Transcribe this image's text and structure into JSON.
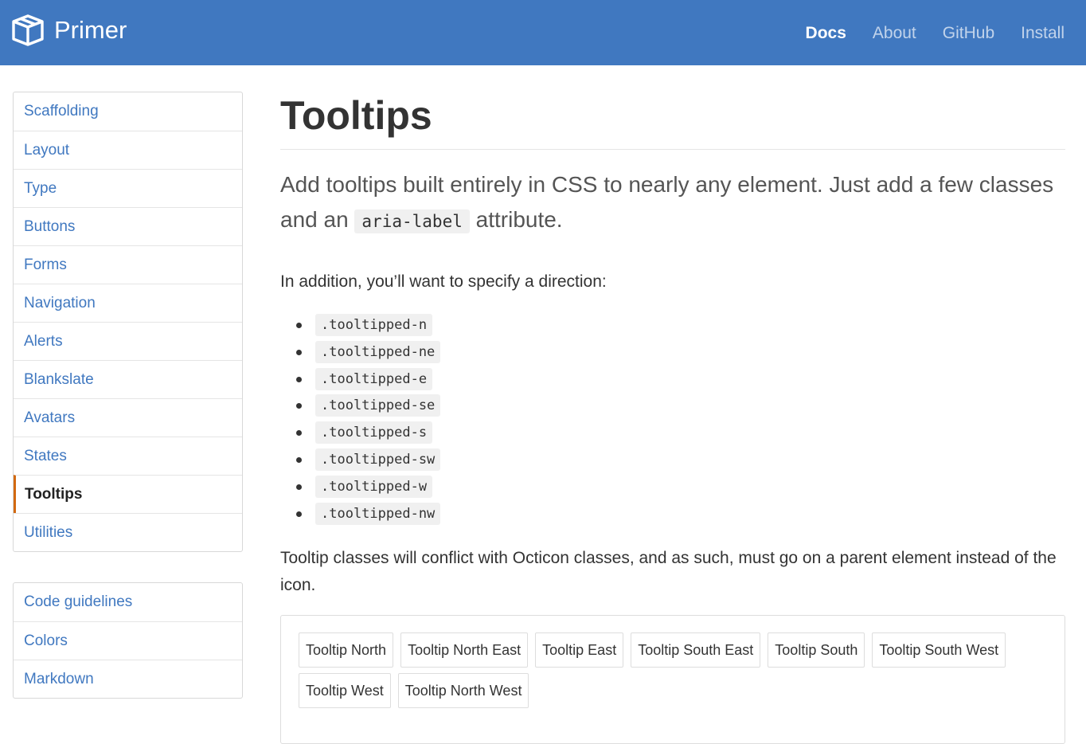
{
  "header": {
    "brand": "Primer",
    "nav": [
      {
        "label": "Docs",
        "active": true
      },
      {
        "label": "About",
        "active": false
      },
      {
        "label": "GitHub",
        "active": false
      },
      {
        "label": "Install",
        "active": false
      }
    ],
    "bg_color": "#4078c0"
  },
  "sidebar": {
    "primary": [
      "Scaffolding",
      "Layout",
      "Type",
      "Buttons",
      "Forms",
      "Navigation",
      "Alerts",
      "Blankslate",
      "Avatars",
      "States",
      "Tooltips",
      "Utilities"
    ],
    "selected": "Tooltips",
    "selected_accent": "#d26911",
    "secondary": [
      "Code guidelines",
      "Colors",
      "Markdown"
    ]
  },
  "content": {
    "title": "Tooltips",
    "lead_before": "Add tooltips built entirely in CSS to nearly any element. Just add a few classes and an ",
    "lead_code": "aria-label",
    "lead_after": " attribute.",
    "intro": "In addition, you’ll want to specify a direction:",
    "directions": [
      ".tooltipped-n",
      ".tooltipped-ne",
      ".tooltipped-e",
      ".tooltipped-se",
      ".tooltipped-s",
      ".tooltipped-sw",
      ".tooltipped-w",
      ".tooltipped-nw"
    ],
    "note": "Tooltip classes will conflict with Octicon classes, and as such, must go on a parent element instead of the icon.",
    "example_buttons": [
      "Tooltip North",
      "Tooltip North East",
      "Tooltip East",
      "Tooltip South East",
      "Tooltip South",
      "Tooltip South West",
      "Tooltip West",
      "Tooltip North West"
    ]
  }
}
